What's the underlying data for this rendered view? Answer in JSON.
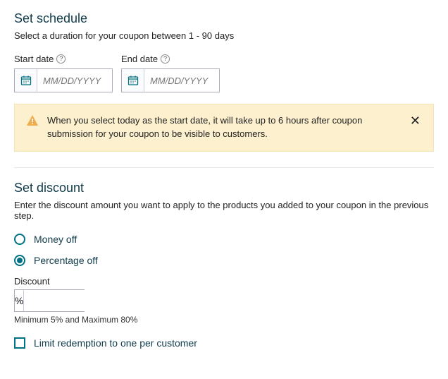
{
  "schedule": {
    "title": "Set schedule",
    "description": "Select a duration for your coupon between 1 - 90 days",
    "start_label": "Start date",
    "end_label": "End date",
    "placeholder": "MM/DD/YYYY"
  },
  "alert": {
    "message": "When you select today as the start date, it will take up to 6 hours after coupon submission for your coupon to be visible to customers."
  },
  "discount": {
    "title": "Set discount",
    "description": "Enter the discount amount you want to apply to the products you added to your coupon in the previous step.",
    "option_money": "Money off",
    "option_percent": "Percentage off",
    "selected": "percent",
    "field_label": "Discount",
    "symbol": "%",
    "hint": "Minimum 5% and Maximum 80%",
    "limit_label": "Limit redemption to one per customer",
    "limit_checked": false
  }
}
